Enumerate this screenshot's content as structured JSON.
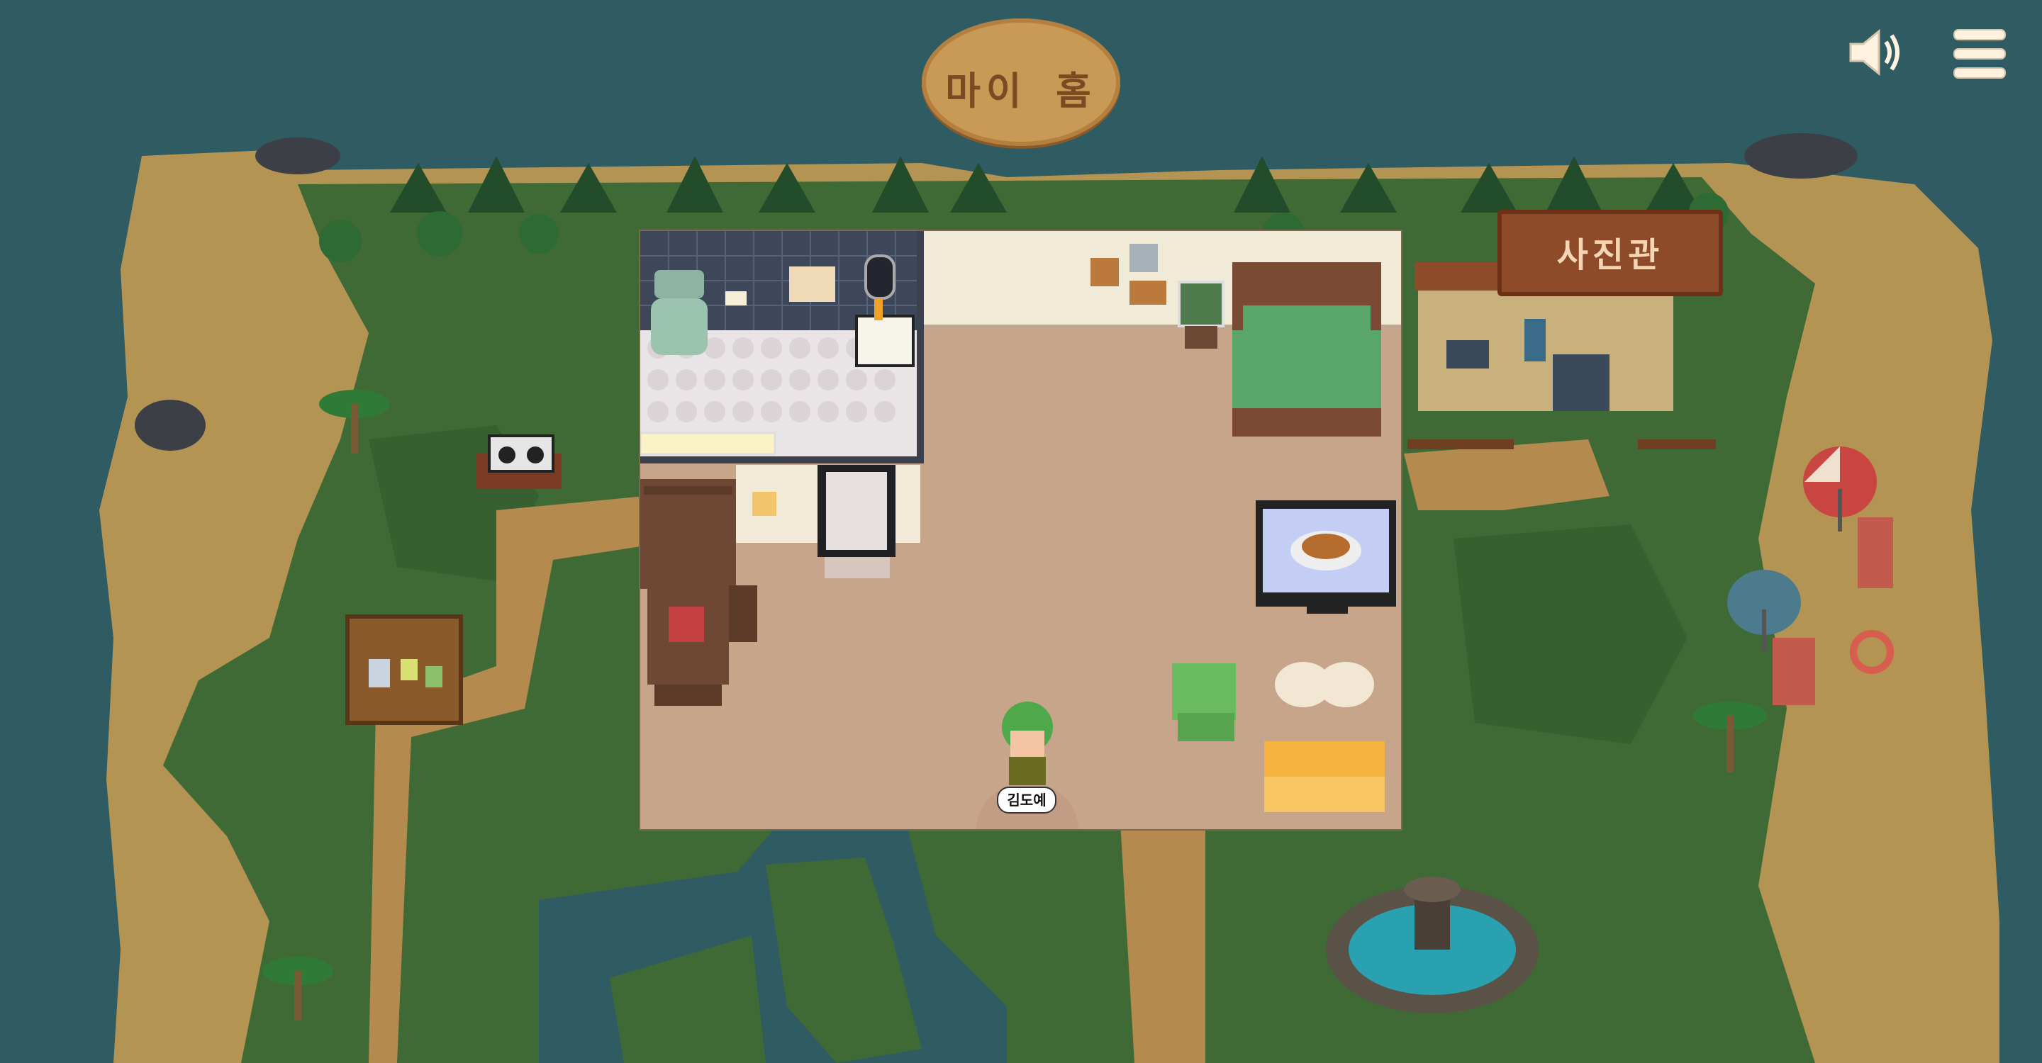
{
  "title_sign": {
    "label": "마이 홈"
  },
  "building_sign": {
    "label": "사진관"
  },
  "player": {
    "name": "김도예"
  },
  "controls": {
    "sound": "speaker-icon",
    "menu": "hamburger-menu-icon"
  },
  "colors": {
    "water": "#2f5b63",
    "sand": "#b49453",
    "grass": "#3f6a35",
    "path": "#b48a4e",
    "floor": "#c7a58a",
    "wall": "#f1ead7",
    "bed": "#5aa66a",
    "sofa": "#f6b340"
  }
}
